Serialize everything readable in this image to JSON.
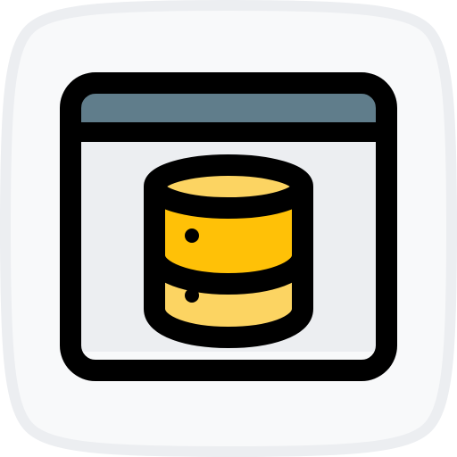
{
  "icon": {
    "name": "database-window-icon",
    "colors": {
      "tile_outline": "#eceef1",
      "tile_fill": "#f8f9fa",
      "window_header": "#607d8b",
      "window_body": "#eceef1",
      "db_top": "#fcd462",
      "db_upper": "#ffc107",
      "db_lower": "#fcd462",
      "stroke": "#000000"
    }
  }
}
